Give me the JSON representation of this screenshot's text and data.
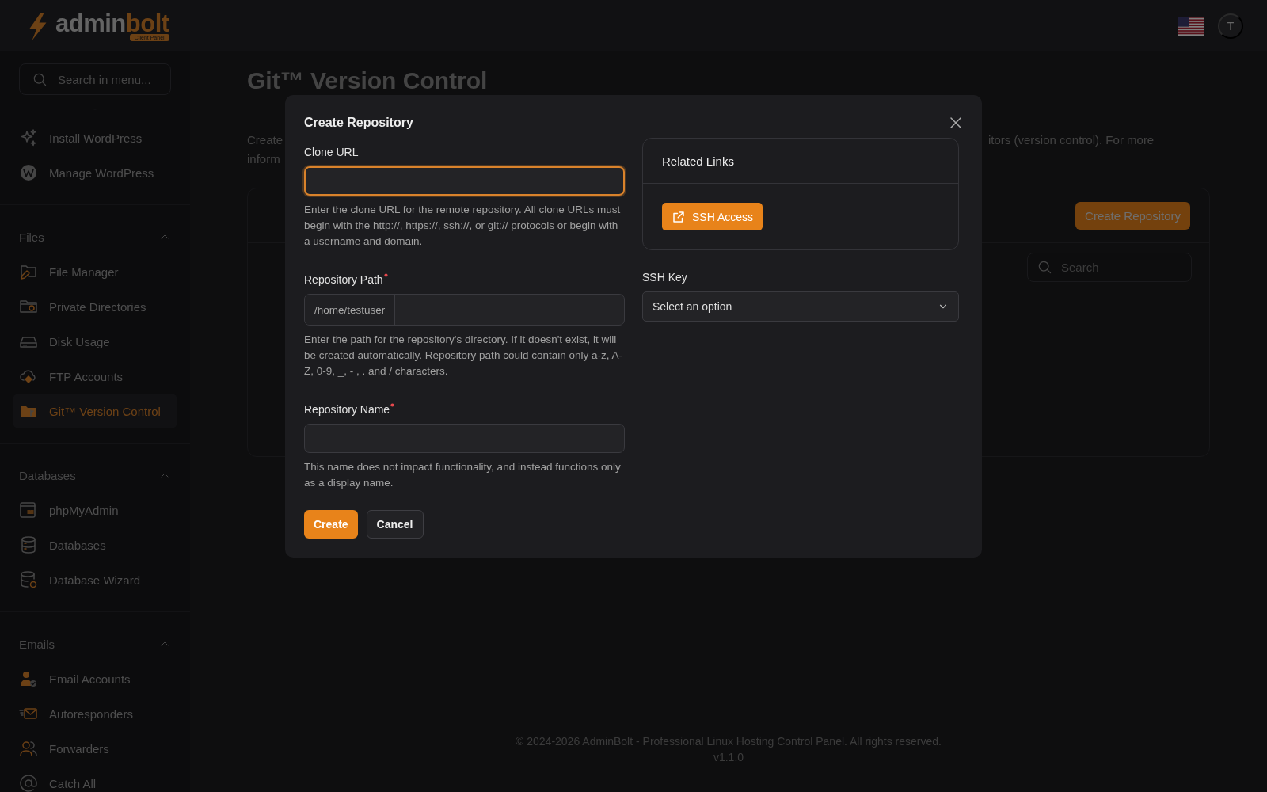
{
  "header": {
    "logo": {
      "text_main": "admin",
      "text_accent": "bolt",
      "badge": "Client Panel"
    },
    "avatar": "T"
  },
  "sidebar": {
    "search": {
      "placeholder": "Search in menu..."
    },
    "separator": "-",
    "groups": [
      {
        "items": [
          {
            "label": "Install WordPress",
            "selected": false
          },
          {
            "label": "Manage WordPress",
            "selected": false
          }
        ]
      },
      {
        "title": "Files",
        "expanded": true,
        "items": [
          {
            "label": "File Manager",
            "selected": false
          },
          {
            "label": "Private Directories",
            "selected": false
          },
          {
            "label": "Disk Usage",
            "selected": false
          },
          {
            "label": "FTP Accounts",
            "selected": false
          },
          {
            "label": "Git™ Version Control",
            "selected": true
          }
        ]
      },
      {
        "title": "Databases",
        "expanded": true,
        "items": [
          {
            "label": "phpMyAdmin",
            "selected": false
          },
          {
            "label": "Databases",
            "selected": false
          },
          {
            "label": "Database Wizard",
            "selected": false
          }
        ]
      },
      {
        "title": "Emails",
        "expanded": true,
        "items": [
          {
            "label": "Email Accounts",
            "selected": false
          },
          {
            "label": "Autoresponders",
            "selected": false
          },
          {
            "label": "Forwarders",
            "selected": false
          },
          {
            "label": "Catch All",
            "selected": false
          }
        ]
      }
    ]
  },
  "page": {
    "title": "Git™ Version Control",
    "description": {
      "line_1_left": "Create",
      "line_1_right": "itors (version control). For more",
      "line_2_left": "inform"
    },
    "create_button": "Create Repository",
    "search": {
      "placeholder": "Search"
    }
  },
  "modal": {
    "title": "Create Repository",
    "fields": [
      {
        "kind": "text",
        "label": "Clone URL",
        "required": false,
        "focused": true,
        "help": "Enter the clone URL for the remote repository. All clone URLs must begin with the http://, https://, ssh://, or git:// protocols or begin with a username and domain."
      },
      {
        "kind": "prefixed",
        "label": "Repository Path",
        "required": true,
        "focused": false,
        "prefix": "/home/testuser",
        "help": "Enter the path for the repository's directory. If it doesn't exist, it will be created automatically. Repository path could contain only a-z, A-Z, 0-9, _, - , . and / characters."
      },
      {
        "kind": "text",
        "label": "Repository Name",
        "required": true,
        "focused": false,
        "help": "This name does not impact functionality, and instead functions only as a display name."
      }
    ],
    "buttons": [
      {
        "label": "Create",
        "kind": "primary"
      },
      {
        "label": "Cancel",
        "kind": "secondary"
      }
    ],
    "related_links": {
      "title": "Related Links",
      "links": [
        "SSH Access"
      ]
    },
    "ssh_key": {
      "label": "SSH Key",
      "placeholder": "Select an option"
    }
  },
  "footer": {
    "copyright": "© 2024-2026 AdminBolt - Professional Linux Hosting Control Panel. All rights reserved.",
    "version": "v1.1.0"
  }
}
